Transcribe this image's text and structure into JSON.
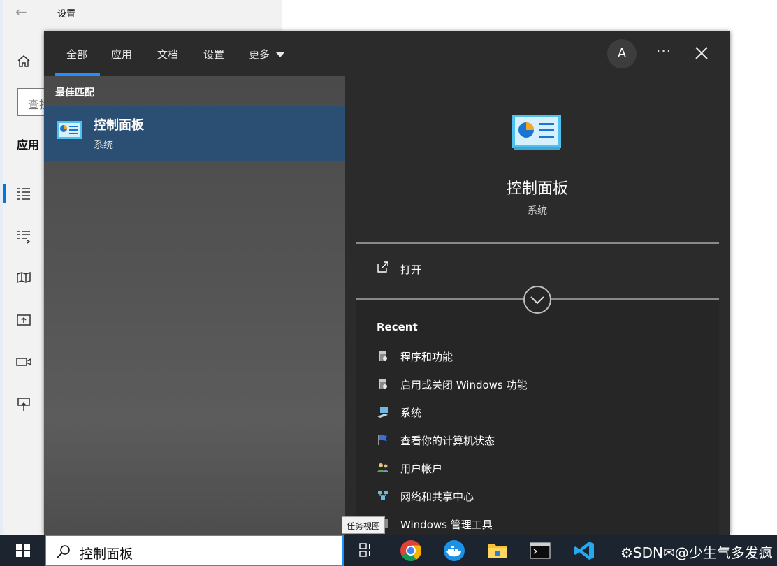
{
  "settings": {
    "title": "设置",
    "search_placeholder": "查找",
    "section_label": "应用"
  },
  "tabs": [
    {
      "label": "全部",
      "active": true
    },
    {
      "label": "应用"
    },
    {
      "label": "文档"
    },
    {
      "label": "设置"
    },
    {
      "label": "更多"
    }
  ],
  "account": {
    "initial": "A"
  },
  "best_match": {
    "heading": "最佳匹配",
    "name": "控制面板",
    "category": "系统"
  },
  "detail": {
    "name": "控制面板",
    "category": "系统",
    "open_label": "打开",
    "recent_heading": "Recent",
    "recent": [
      {
        "label": "程序和功能",
        "icon": "programs-icon"
      },
      {
        "label": "启用或关闭 Windows 功能",
        "icon": "windows-features-icon"
      },
      {
        "label": "系统",
        "icon": "system-icon"
      },
      {
        "label": "查看你的计算机状态",
        "icon": "security-flag-icon"
      },
      {
        "label": "用户帐户",
        "icon": "user-accounts-icon"
      },
      {
        "label": "网络和共享中心",
        "icon": "network-icon"
      },
      {
        "label": "Windows 管理工具",
        "icon": "admin-tools-icon"
      }
    ]
  },
  "tooltip": "任务视图",
  "taskbar": {
    "search_text": "控制面板",
    "apps": [
      "task-view",
      "chrome",
      "docker",
      "file-explorer",
      "terminal",
      "vscode"
    ],
    "tray_text": "⚙SDN✉@少生气多发疯"
  },
  "colors": {
    "accent": "#1e90ff",
    "selected_item": "#2a4f73",
    "panel_bg": "#2b2b2b",
    "taskbar_bg": "#1c2430"
  }
}
